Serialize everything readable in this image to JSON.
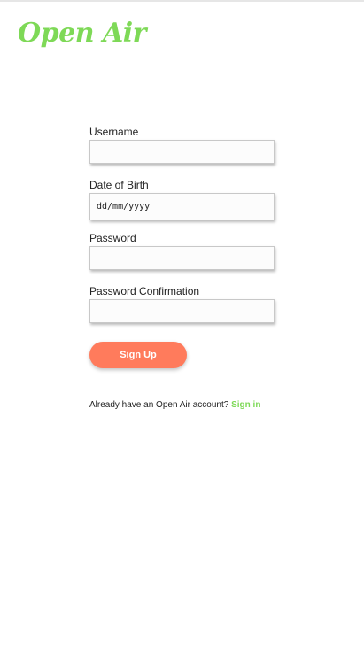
{
  "app": {
    "logo_text": "Open Air"
  },
  "form": {
    "username_label": "Username",
    "username_value": "",
    "dob_label": "Date of Birth",
    "dob_placeholder": "dd/mm/yyyy",
    "password_label": "Password",
    "password_value": "",
    "password_confirm_label": "Password Confirmation",
    "password_confirm_value": "",
    "submit_label": "Sign Up"
  },
  "footer": {
    "prompt_text": "Already have an Open Air account?",
    "signin_label": "Sign in"
  },
  "colors": {
    "brand_green": "#7ed957",
    "button_coral": "#ff7b5c"
  }
}
